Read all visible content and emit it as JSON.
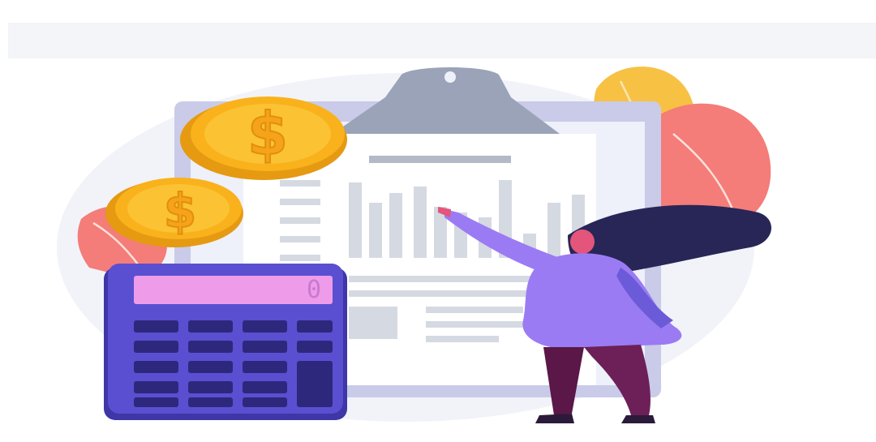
{
  "illustration": {
    "calculator": {
      "display_value": "0"
    },
    "colors": {
      "coin": "#f9b21c",
      "calculator": "#5a4fd0",
      "clipboard": "#c9cbe8",
      "leaf_pink": "#f47c79",
      "leaf_yellow": "#f7c144",
      "hair": "#282657",
      "sweater": "#9a7bf3",
      "pants": "#6c2057"
    }
  }
}
